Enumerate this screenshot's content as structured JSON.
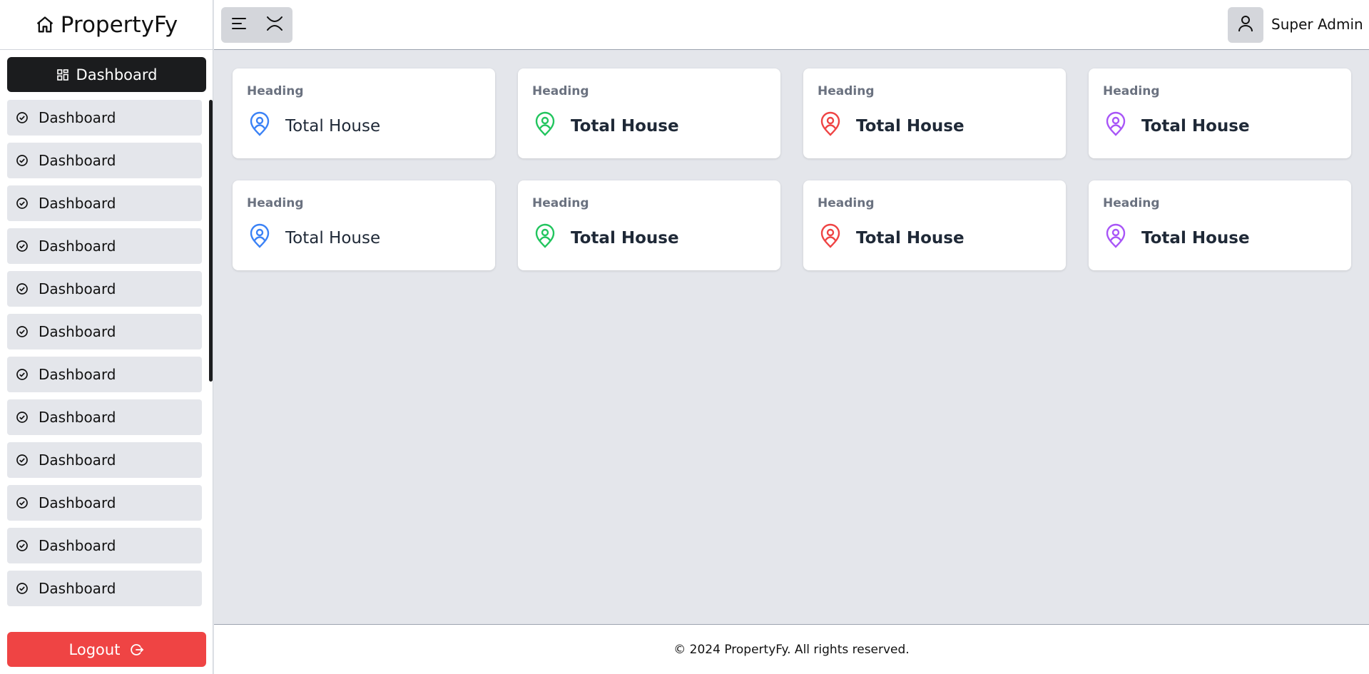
{
  "brand": {
    "name": "PropertyFy",
    "icon": "home-icon"
  },
  "sidebar": {
    "active": {
      "label": "Dashboard",
      "icon": "grid-icon"
    },
    "items": [
      {
        "label": "Dashboard",
        "icon": "check-circle-icon"
      },
      {
        "label": "Dashboard",
        "icon": "check-circle-icon"
      },
      {
        "label": "Dashboard",
        "icon": "check-circle-icon"
      },
      {
        "label": "Dashboard",
        "icon": "check-circle-icon"
      },
      {
        "label": "Dashboard",
        "icon": "check-circle-icon"
      },
      {
        "label": "Dashboard",
        "icon": "check-circle-icon"
      },
      {
        "label": "Dashboard",
        "icon": "check-circle-icon"
      },
      {
        "label": "Dashboard",
        "icon": "check-circle-icon"
      },
      {
        "label": "Dashboard",
        "icon": "check-circle-icon"
      },
      {
        "label": "Dashboard",
        "icon": "check-circle-icon"
      },
      {
        "label": "Dashboard",
        "icon": "check-circle-icon"
      },
      {
        "label": "Dashboard",
        "icon": "check-circle-icon"
      },
      {
        "label": "",
        "icon": ""
      }
    ],
    "logout": {
      "label": "Logout",
      "icon": "logout-icon"
    }
  },
  "header": {
    "menu_icon": "menu-icon",
    "close_icon": "close-icon",
    "user": {
      "name": "Super Admin",
      "icon": "user-icon"
    }
  },
  "cards": [
    {
      "heading": "Heading",
      "value": "Total House",
      "color": "#3b82f6",
      "bold": false
    },
    {
      "heading": "Heading",
      "value": "Total House",
      "color": "#22c55e",
      "bold": true
    },
    {
      "heading": "Heading",
      "value": "Total House",
      "color": "#ef4444",
      "bold": true
    },
    {
      "heading": "Heading",
      "value": "Total House",
      "color": "#a855f7",
      "bold": true
    },
    {
      "heading": "Heading",
      "value": "Total House",
      "color": "#3b82f6",
      "bold": false
    },
    {
      "heading": "Heading",
      "value": "Total House",
      "color": "#22c55e",
      "bold": true
    },
    {
      "heading": "Heading",
      "value": "Total House",
      "color": "#ef4444",
      "bold": true
    },
    {
      "heading": "Heading",
      "value": "Total House",
      "color": "#a855f7",
      "bold": true
    }
  ],
  "footer": {
    "text": "© 2024 PropertyFy. All rights reserved."
  },
  "colors": {
    "accent_dark": "#1b1c1e",
    "logout": "#ef4444",
    "background": "#e4e6eb"
  }
}
